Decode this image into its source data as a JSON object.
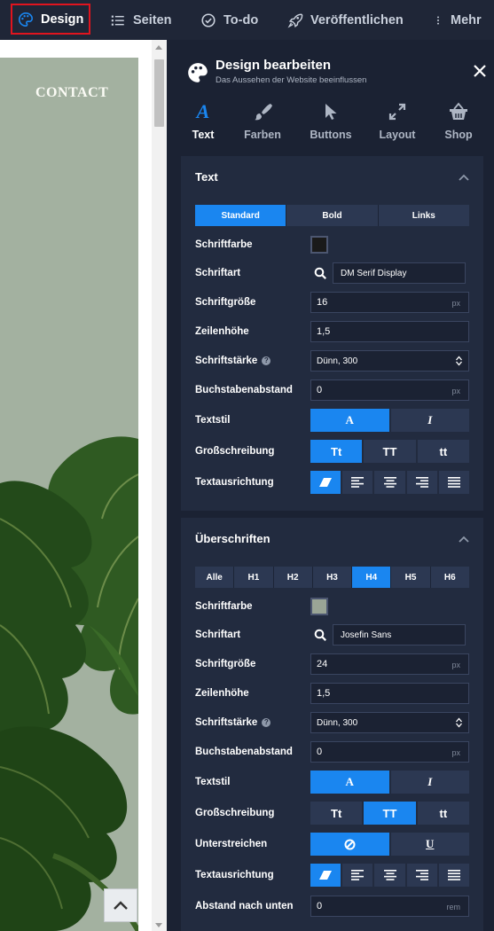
{
  "topbar": {
    "items": [
      {
        "label": "Design",
        "icon": "palette-icon"
      },
      {
        "label": "Seiten",
        "icon": "list-icon"
      },
      {
        "label": "To-do",
        "icon": "check-circle-icon"
      },
      {
        "label": "Veröffentlichen",
        "icon": "rocket-icon"
      },
      {
        "label": "Mehr",
        "icon": "more-vertical-icon"
      }
    ]
  },
  "preview": {
    "heading": "CONTACT"
  },
  "panel": {
    "title": "Design bearbeiten",
    "subtitle": "Das Aussehen der Website beeinflussen",
    "tabs": [
      {
        "label": "Text",
        "icon": "text-a-icon"
      },
      {
        "label": "Farben",
        "icon": "brush-icon"
      },
      {
        "label": "Buttons",
        "icon": "cursor-icon"
      },
      {
        "label": "Layout",
        "icon": "expand-icon"
      },
      {
        "label": "Shop",
        "icon": "basket-icon"
      }
    ]
  },
  "text_section": {
    "title": "Text",
    "tabs": [
      "Standard",
      "Bold",
      "Links"
    ],
    "active_tab": "Standard",
    "labels": {
      "color": "Schriftfarbe",
      "font": "Schriftart",
      "size": "Schriftgröße",
      "line_height": "Zeilenhöhe",
      "weight": "Schriftstärke",
      "letter_spacing": "Buchstabenabstand",
      "style": "Textstil",
      "case": "Großschreibung",
      "align": "Textausrichtung"
    },
    "color_value": "#1a1a1a",
    "font_value": "DM Serif Display",
    "size_value": "16",
    "size_unit": "px",
    "line_height_value": "1,5",
    "weight_value": "Dünn, 300",
    "letter_spacing_value": "0",
    "letter_spacing_unit": "px",
    "style_options": [
      "A",
      "I"
    ],
    "case_options": [
      "Tt",
      "TT",
      "tt"
    ]
  },
  "headings_section": {
    "title": "Überschriften",
    "tabs": [
      "Alle",
      "H1",
      "H2",
      "H3",
      "H4",
      "H5",
      "H6"
    ],
    "active_tab": "H4",
    "labels": {
      "color": "Schriftfarbe",
      "font": "Schriftart",
      "size": "Schriftgröße",
      "line_height": "Zeilenhöhe",
      "weight": "Schriftstärke",
      "letter_spacing": "Buchstabenabstand",
      "style": "Textstil",
      "case": "Großschreibung",
      "underline": "Unterstreichen",
      "align": "Textausrichtung",
      "spacing_below": "Abstand nach unten"
    },
    "color_value": "#9aa596",
    "font_value": "Josefin Sans",
    "size_value": "24",
    "size_unit": "px",
    "line_height_value": "1,5",
    "weight_value": "Dünn, 300",
    "letter_spacing_value": "0",
    "letter_spacing_unit": "px",
    "style_options": [
      "A",
      "I"
    ],
    "case_options": [
      "Tt",
      "TT",
      "tt"
    ],
    "underline_options": [
      "U"
    ],
    "spacing_below_value": "0",
    "spacing_below_unit": "rem"
  },
  "colors": {
    "accent": "#1a86f0",
    "highlight_border": "#e0141e"
  }
}
